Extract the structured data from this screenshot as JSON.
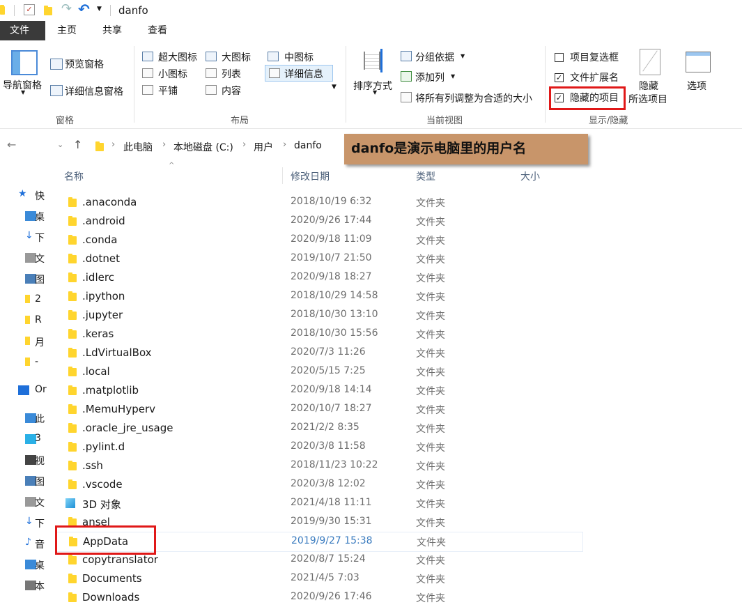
{
  "window": {
    "title": "danfo"
  },
  "tabs": [
    {
      "label": "文件",
      "active": true
    },
    {
      "label": "主页",
      "active": false
    },
    {
      "label": "共享",
      "active": false
    },
    {
      "label": "查看",
      "active": false
    }
  ],
  "ribbon": {
    "pane": {
      "nav_pane": "导航窗格",
      "preview_pane": "预览窗格",
      "details_pane": "详细信息窗格",
      "group_label": "窗格"
    },
    "layout": {
      "items": [
        "超大图标",
        "大图标",
        "中图标",
        "小图标",
        "列表",
        "详细信息",
        "平铺",
        "内容"
      ],
      "group_label": "布局"
    },
    "current_view": {
      "sort_by": "排序方式",
      "group_by": "分组依据",
      "add_column": "添加列",
      "size_all_columns": "将所有列调整为合适的大小",
      "group_label": "当前视图"
    },
    "show_hide": {
      "item_checkboxes": {
        "label": "项目复选框",
        "checked": false
      },
      "file_extensions": {
        "label": "文件扩展名",
        "checked": true
      },
      "hidden_items": {
        "label": "隐藏的项目",
        "checked": true
      },
      "hide_selected_1": "隐藏",
      "hide_selected_2": "所选项目",
      "options": "选项",
      "group_label": "显示/隐藏"
    }
  },
  "address_bar": {
    "breadcrumb": [
      "此电脑",
      "本地磁盘 (C:)",
      "用户",
      "danfo"
    ]
  },
  "annotation": {
    "text": "danfo是演示电脑里的用户名"
  },
  "nav_pane": [
    {
      "icon": "star-icon",
      "label": "快"
    },
    {
      "icon": "desktop-icon",
      "label": "桌"
    },
    {
      "icon": "download-icon",
      "label": "下"
    },
    {
      "icon": "document-icon",
      "label": "文"
    },
    {
      "icon": "picture-icon",
      "label": "图"
    },
    {
      "icon": "folder-icon",
      "label": "2"
    },
    {
      "icon": "folder-icon",
      "label": "R"
    },
    {
      "icon": "folder-icon",
      "label": "月"
    },
    {
      "icon": "folder-icon",
      "label": "-"
    },
    {
      "icon": "cloud-icon",
      "label": "Or"
    },
    {
      "icon": "pc-icon",
      "label": "此"
    },
    {
      "icon": "3d-icon",
      "label": "3"
    },
    {
      "icon": "video-icon",
      "label": "视"
    },
    {
      "icon": "picture-icon",
      "label": "图"
    },
    {
      "icon": "document-icon",
      "label": "文"
    },
    {
      "icon": "download-icon",
      "label": "下"
    },
    {
      "icon": "music-icon",
      "label": "音"
    },
    {
      "icon": "desktop-icon",
      "label": "桌"
    },
    {
      "icon": "drive-icon",
      "label": "本"
    }
  ],
  "columns": {
    "name": "名称",
    "date": "修改日期",
    "type": "类型",
    "size": "大小"
  },
  "files": [
    {
      "name": ".anaconda",
      "date": "2018/10/19 6:32",
      "type": "文件夹"
    },
    {
      "name": ".android",
      "date": "2020/9/26 17:44",
      "type": "文件夹"
    },
    {
      "name": ".conda",
      "date": "2020/9/18 11:09",
      "type": "文件夹"
    },
    {
      "name": ".dotnet",
      "date": "2019/10/7 21:50",
      "type": "文件夹"
    },
    {
      "name": ".idlerc",
      "date": "2020/9/18 18:27",
      "type": "文件夹"
    },
    {
      "name": ".ipython",
      "date": "2018/10/29 14:58",
      "type": "文件夹"
    },
    {
      "name": ".jupyter",
      "date": "2018/10/30 13:10",
      "type": "文件夹"
    },
    {
      "name": ".keras",
      "date": "2018/10/30 15:56",
      "type": "文件夹"
    },
    {
      "name": ".LdVirtualBox",
      "date": "2020/7/3 11:26",
      "type": "文件夹"
    },
    {
      "name": ".local",
      "date": "2020/5/15 7:25",
      "type": "文件夹"
    },
    {
      "name": ".matplotlib",
      "date": "2020/9/18 14:14",
      "type": "文件夹"
    },
    {
      "name": ".MemuHyperv",
      "date": "2020/10/7 18:27",
      "type": "文件夹"
    },
    {
      "name": ".oracle_jre_usage",
      "date": "2021/2/2 8:35",
      "type": "文件夹"
    },
    {
      "name": ".pylint.d",
      "date": "2020/3/8 11:58",
      "type": "文件夹"
    },
    {
      "name": ".ssh",
      "date": "2018/11/23 10:22",
      "type": "文件夹"
    },
    {
      "name": ".vscode",
      "date": "2020/3/8 12:02",
      "type": "文件夹"
    },
    {
      "name": "3D 对象",
      "date": "2021/4/18 11:11",
      "type": "文件夹",
      "icon": "3d-icon"
    },
    {
      "name": "ansel",
      "date": "2019/9/30 15:31",
      "type": "文件夹"
    },
    {
      "name": "AppData",
      "date": "2019/9/27 15:38",
      "type": "文件夹",
      "selected": true
    },
    {
      "name": "copytranslator",
      "date": "2020/8/7 15:24",
      "type": "文件夹"
    },
    {
      "name": "Documents",
      "date": "2021/4/5 7:03",
      "type": "文件夹"
    },
    {
      "name": "Downloads",
      "date": "2020/9/26 17:46",
      "type": "文件夹"
    }
  ],
  "colors": {
    "highlight": "#e01818",
    "annotation_bg": "#c8956a",
    "tab_active": "#3a3a3a"
  }
}
